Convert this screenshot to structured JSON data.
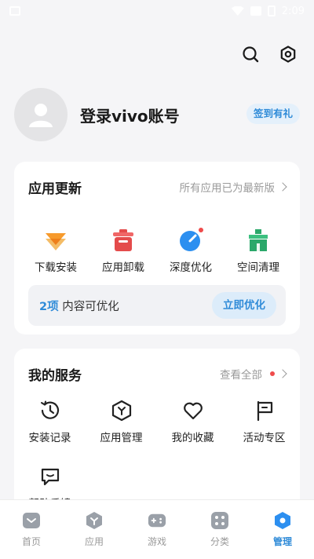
{
  "status_bar": {
    "time": "2:09"
  },
  "profile": {
    "login_label": "登录vivo账号",
    "signin_badge": "签到有礼"
  },
  "updates": {
    "title": "应用更新",
    "status": "所有应用已为最新版",
    "tools": [
      {
        "label": "下载安装",
        "icon": "download-install-icon"
      },
      {
        "label": "应用卸载",
        "icon": "uninstall-icon"
      },
      {
        "label": "深度优化",
        "icon": "deep-optimize-icon"
      },
      {
        "label": "空间清理",
        "icon": "space-clean-icon"
      }
    ],
    "optimize": {
      "count": "2项",
      "text": " 内容可优化",
      "button": "立即优化"
    }
  },
  "services": {
    "title": "我的服务",
    "view_all": "查看全部",
    "items": [
      {
        "label": "安装记录",
        "icon": "install-history-icon"
      },
      {
        "label": "应用管理",
        "icon": "app-manage-icon"
      },
      {
        "label": "我的收藏",
        "icon": "heart-icon"
      },
      {
        "label": "活动专区",
        "icon": "flag-icon"
      },
      {
        "label": "帮助反馈",
        "icon": "feedback-icon"
      }
    ]
  },
  "tabbar": {
    "items": [
      {
        "label": "首页",
        "active": false
      },
      {
        "label": "应用",
        "active": false
      },
      {
        "label": "游戏",
        "active": false
      },
      {
        "label": "分类",
        "active": false
      },
      {
        "label": "管理",
        "active": true
      }
    ]
  },
  "colors": {
    "accent": "#2f8bd8",
    "inactive": "#9a9a9a",
    "background": "#f5f5f7"
  }
}
